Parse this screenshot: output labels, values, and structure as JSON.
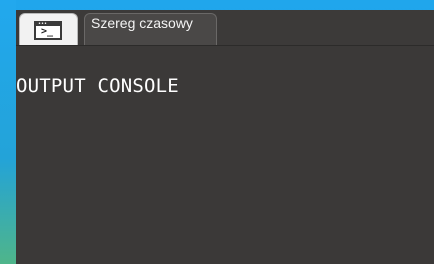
{
  "tabs": [
    {
      "icon": "console-icon",
      "active": true
    },
    {
      "label": "Szereg czasowy",
      "active": false
    }
  ],
  "console": {
    "title": "OUTPUT CONSOLE"
  }
}
